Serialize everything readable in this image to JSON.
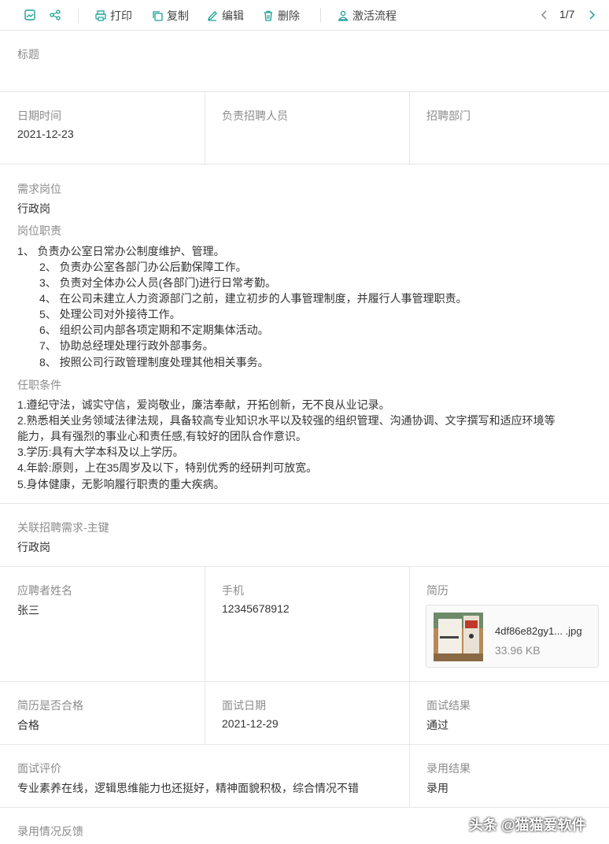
{
  "toolbar": {
    "print": "打印",
    "copy": "复制",
    "edit": "编辑",
    "delete": "删除",
    "activate": "激活流程",
    "pager": "1/7"
  },
  "title_section": {
    "label": "标题",
    "value": ""
  },
  "row1": {
    "date_label": "日期时间",
    "date_value": "2021-12-23",
    "recruiter_label": "负责招聘人员",
    "recruiter_value": "",
    "dept_label": "招聘部门",
    "dept_value": ""
  },
  "position": {
    "label": "需求岗位",
    "value": "行政岗",
    "duties_label": "岗位职责",
    "duties": [
      "1、 负责办公室日常办公制度维护、管理。",
      "2、 负责办公室各部门办公后勤保障工作。",
      "3、 负责对全体办公人员(各部门)进行日常考勤。",
      "4、 在公司未建立人力资源部门之前，建立初步的人事管理制度，并履行人事管理职责。",
      "5、 处理公司对外接待工作。",
      "6、 组织公司内部各项定期和不定期集体活动。",
      "7、 协助总经理处理行政外部事务。",
      "8、 按照公司行政管理制度处理其他相关事务。"
    ],
    "requirements_label": "任职条件",
    "requirements": [
      "1.遵纪守法，诚实守信，爱岗敬业，廉洁奉献，开拓创新，无不良从业记录。",
      "2.熟悉相关业务领域法律法规，具备较高专业知识水平以及较强的组织管理、沟通协调、文字撰写和适应环境等",
      "能力，具有强烈的事业心和责任感,有较好的团队合作意识。",
      "3.学历:具有大学本科及以上学历。",
      "4.年龄:原则，上在35周岁及以下，特别优秀的经研判可放宽。",
      "5.身体健康，无影响履行职责的重大疾病。"
    ]
  },
  "related": {
    "label": "关联招聘需求-主键",
    "value": "行政岗"
  },
  "applicant": {
    "name_label": "应聘者姓名",
    "name_value": "张三",
    "phone_label": "手机",
    "phone_value": "12345678912",
    "resume_label": "简历",
    "file_name": "4df86e82gy1...  .jpg",
    "file_size": "33.96 KB"
  },
  "interview": {
    "qualified_label": "简历是否合格",
    "qualified_value": "合格",
    "date_label": "面试日期",
    "date_value": "2021-12-29",
    "result_label": "面试结果",
    "result_value": "通过"
  },
  "evaluation": {
    "eval_label": "面试评价",
    "eval_value": "专业素养在线，逻辑思维能力也还挺好，精神面貌积极，综合情况不错",
    "hire_label": "录用结果",
    "hire_value": "录用"
  },
  "feedback": {
    "label": "录用情况反馈"
  },
  "watermark": "头条 @猫猫爱软件",
  "colors": {
    "accent": "#1aa094",
    "border": "#e6e6e6",
    "label": "#8c8c8c"
  }
}
